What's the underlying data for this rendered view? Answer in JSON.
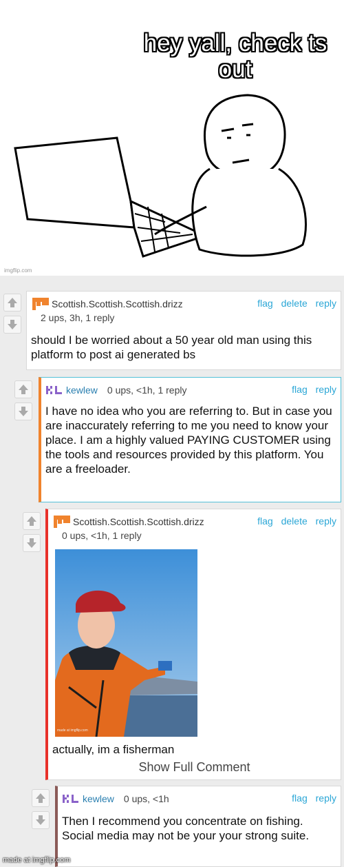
{
  "meme": {
    "caption": "hey yall, check ts out",
    "watermark": "imgflip.com"
  },
  "comments": [
    {
      "user": "Scottish.Scottish.Scottish.drizz",
      "avatar_icon": "orange-pixel-flag-icon",
      "meta": "2 ups, 3h, 1 reply",
      "actions": {
        "flag": "flag",
        "delete": "delete",
        "reply": "reply"
      },
      "text": "should I be worried about a 50 year old man using this platform to post ai generated bs"
    },
    {
      "user": "kewlew",
      "avatar_icon": "purple-kl-logo-icon",
      "meta": "0 ups, <1h, 1 reply",
      "actions": {
        "flag": "flag",
        "reply": "reply"
      },
      "text": "I have no idea who you are referring to. But in case you are inaccurately referring to me you need to know your place. I am a highly valued PAYING CUSTOMER using the tools and resources provided by this platform. You are a freeloader."
    },
    {
      "user": "Scottish.Scottish.Scottish.drizz",
      "avatar_icon": "orange-pixel-flag-icon",
      "meta": "0 ups, <1h, 1 reply",
      "actions": {
        "flag": "flag",
        "delete": "delete",
        "reply": "reply"
      },
      "photo_watermark": "made at imgflip.com",
      "text": "actually, im a fisherman",
      "show_full": "Show Full Comment"
    },
    {
      "user": "kewlew",
      "avatar_icon": "purple-kl-logo-icon",
      "meta": "0 ups, <1h",
      "actions": {
        "flag": "flag",
        "reply": "reply"
      },
      "text": "Then I recommend you concentrate on fishing. Social media may not be your your strong suite."
    }
  ],
  "footer_watermark": "made at imgflip.com",
  "colors": {
    "link": "#2aa6d6",
    "orange_bar": "#f0832d",
    "red_bar": "#e8312a",
    "brown_bar": "#8a5a57",
    "selected_border": "#53c1d8"
  }
}
